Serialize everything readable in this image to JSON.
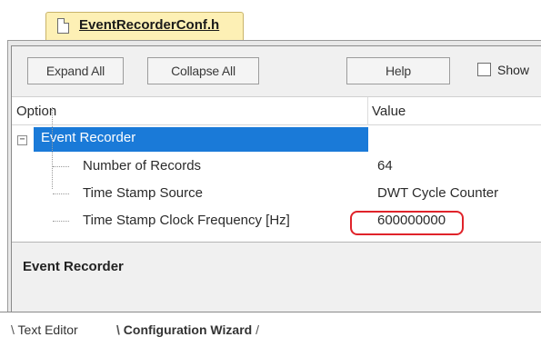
{
  "file_tab": {
    "label": "EventRecorderConf.h"
  },
  "toolbar": {
    "expand_all": "Expand All",
    "collapse_all": "Collapse All",
    "help": "Help",
    "show_label": "Show"
  },
  "columns": {
    "option": "Option",
    "value": "Value"
  },
  "tree": {
    "group": {
      "label": "Event Recorder",
      "expander": "−"
    },
    "items": [
      {
        "option": "Number of Records",
        "value": "64"
      },
      {
        "option": "Time Stamp Source",
        "value": "DWT Cycle Counter"
      },
      {
        "option": "Time Stamp Clock Frequency [Hz]",
        "value": "600000000"
      }
    ]
  },
  "description": {
    "title": "Event Recorder"
  },
  "bottom_tabs": [
    {
      "label": "Text Editor"
    },
    {
      "label": "Configuration Wizard"
    }
  ],
  "colors": {
    "selection": "#1a7ad8",
    "highlight_border": "#e0232a",
    "file_tab_bg": "#fdf0b5"
  }
}
